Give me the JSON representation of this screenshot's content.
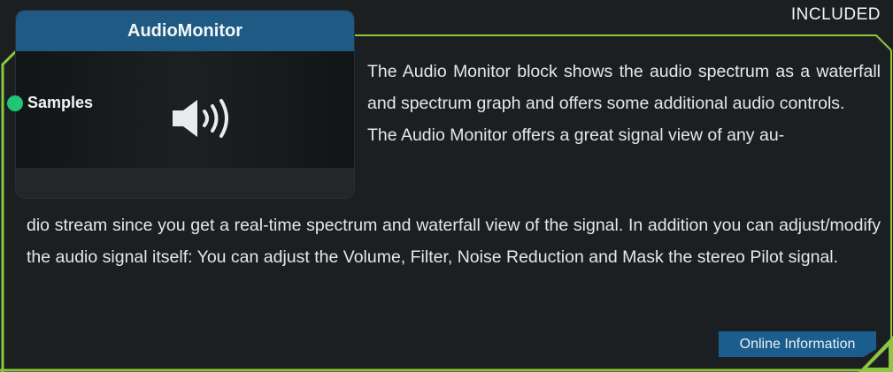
{
  "badge": {
    "text": "INCLUDED"
  },
  "block": {
    "title": "AudioMonitor",
    "port_label": "Samples",
    "icon": "speaker-volume-icon"
  },
  "description": {
    "line1": "The Audio Monitor block shows the audio spectrum as a waterfall and spectrum graph and offers some additional audio controls.",
    "line2_start": "The Audio Monitor offers a great signal view of any au-",
    "line2_rest": "dio stream since you get a real-time spectrum and waterfall view of the signal. In addition you can adjust/modify the audio signal itself: You can adjust the Volume, Filter, Noise Reduction and Mask the stereo Pilot signal."
  },
  "links": {
    "online_info": "Online Information"
  },
  "colors": {
    "accent_green": "#8dc63f",
    "header_blue": "#1e5a83",
    "port_green": "#1fc676",
    "button_blue": "#1b5d8c"
  }
}
